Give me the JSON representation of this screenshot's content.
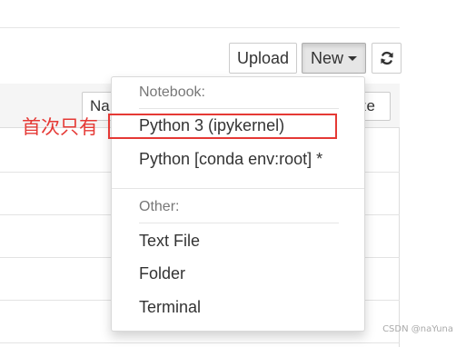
{
  "toolbar": {
    "upload_label": "Upload",
    "new_label": "New",
    "refresh_icon": "refresh-icon"
  },
  "list": {
    "name_header": "Na",
    "size_header": "ze"
  },
  "annotation": {
    "text": "首次只有"
  },
  "new_menu": {
    "notebook_header": "Notebook:",
    "kernels": [
      "Python 3 (ipykernel)",
      "Python [conda env:root] *"
    ],
    "other_header": "Other:",
    "others": [
      "Text File",
      "Folder",
      "Terminal"
    ]
  },
  "colors": {
    "annotation_red": "#e53935",
    "new_button_active_bg": "#e6e6e6"
  },
  "watermark": "CSDN @naYuna"
}
